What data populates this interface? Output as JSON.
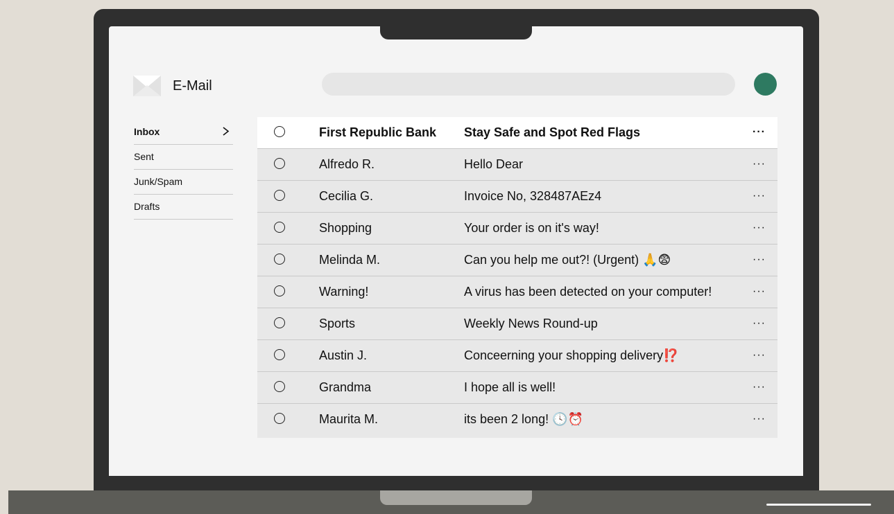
{
  "app": {
    "title": "E-Mail",
    "logo_icon": "envelope-icon",
    "accent_color": "#2e7a61"
  },
  "search": {
    "value": "",
    "placeholder": ""
  },
  "sidebar": {
    "items": [
      {
        "label": "Inbox",
        "active": true,
        "icon": "chevron-right-icon"
      },
      {
        "label": "Sent",
        "active": false
      },
      {
        "label": "Junk/Spam",
        "active": false
      },
      {
        "label": "Drafts",
        "active": false
      }
    ]
  },
  "emails": [
    {
      "sender": "First Republic Bank",
      "subject": "Stay Safe and Spot Red Flags",
      "more": "···",
      "selected": true
    },
    {
      "sender": "Alfredo R.",
      "subject": "Hello Dear",
      "more": "···"
    },
    {
      "sender": "Cecilia G.",
      "subject": "Invoice No, 328487AEz4",
      "more": "···"
    },
    {
      "sender": "Shopping",
      "subject": "Your order is on it's way!",
      "more": "···"
    },
    {
      "sender": "Melinda M.",
      "subject": "Can you help me out?! (Urgent) 🙏😨",
      "more": "···"
    },
    {
      "sender": "Warning!",
      "subject": "A virus has been detected on your computer!",
      "more": "···"
    },
    {
      "sender": "Sports",
      "subject": "Weekly News Round-up",
      "more": "···"
    },
    {
      "sender": "Austin J.",
      "subject": "Conceerning your shopping delivery⁉️",
      "more": "···"
    },
    {
      "sender": "Grandma",
      "subject": "I hope all is well!",
      "more": "···"
    },
    {
      "sender": "Maurita M.",
      "subject": "its been 2 long! 🕓⏰",
      "more": "···"
    }
  ]
}
